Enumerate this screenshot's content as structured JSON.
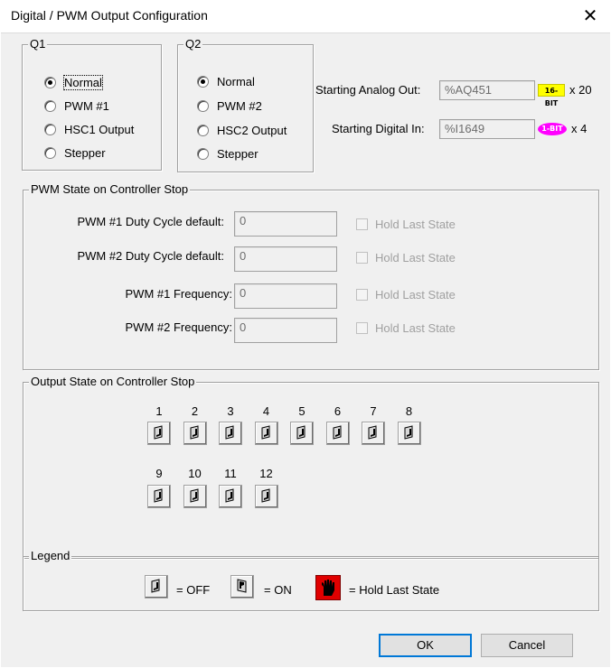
{
  "window": {
    "title": "Digital / PWM Output Configuration",
    "close_glyph": "✕"
  },
  "q1": {
    "legend": "Q1",
    "options": [
      "Normal",
      "PWM #1",
      "HSC1 Output",
      "Stepper"
    ],
    "selected": "Normal"
  },
  "q2": {
    "legend": "Q2",
    "options": [
      "Normal",
      "PWM #2",
      "HSC2 Output",
      "Stepper"
    ],
    "selected": "Normal"
  },
  "addresses": {
    "analog_label": "Starting Analog Out:",
    "analog_value": "%AQ451",
    "analog_badge": "16-BIT",
    "analog_badge_color": "#ffff00",
    "analog_count": "x 20",
    "digital_label": "Starting Digital In:",
    "digital_value": "%I1649",
    "digital_badge": "1-BIT",
    "digital_badge_color": "#ff00ff",
    "digital_count": "x 4"
  },
  "pwm_stop": {
    "legend": "PWM State on Controller Stop",
    "rows": [
      {
        "label": "PWM #1 Duty Cycle default:",
        "value": "0",
        "hold_label": "Hold Last State"
      },
      {
        "label": "PWM #2 Duty Cycle default:",
        "value": "0",
        "hold_label": "Hold Last State"
      },
      {
        "label": "PWM #1 Frequency:",
        "value": "0",
        "hold_label": "Hold Last State"
      },
      {
        "label": "PWM #2 Frequency:",
        "value": "0",
        "hold_label": "Hold Last State"
      }
    ]
  },
  "output_stop": {
    "legend": "Output State on Controller Stop",
    "outputs": [
      {
        "num": "1",
        "state": "OFF"
      },
      {
        "num": "2",
        "state": "OFF"
      },
      {
        "num": "3",
        "state": "OFF"
      },
      {
        "num": "4",
        "state": "OFF"
      },
      {
        "num": "5",
        "state": "OFF"
      },
      {
        "num": "6",
        "state": "OFF"
      },
      {
        "num": "7",
        "state": "OFF"
      },
      {
        "num": "8",
        "state": "OFF"
      },
      {
        "num": "9",
        "state": "OFF"
      },
      {
        "num": "10",
        "state": "OFF"
      },
      {
        "num": "11",
        "state": "OFF"
      },
      {
        "num": "12",
        "state": "OFF"
      }
    ]
  },
  "legend_box": {
    "legend": "Legend",
    "off_text": "= OFF",
    "on_text": "= ON",
    "hold_text": "= Hold Last State"
  },
  "buttons": {
    "ok": "OK",
    "cancel": "Cancel"
  },
  "icons": {
    "off": "switch-off-icon",
    "on": "switch-on-icon",
    "hold": "hold-hand-icon"
  },
  "colors": {
    "hold_red": "#e00000",
    "focus_blue": "#0078d7"
  }
}
